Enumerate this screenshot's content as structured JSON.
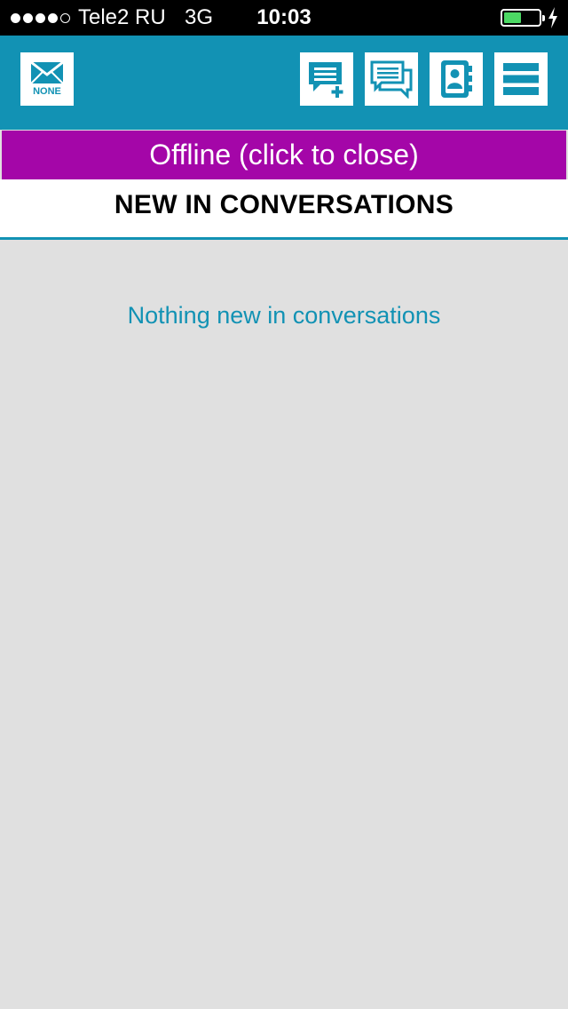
{
  "status_bar": {
    "carrier": "Tele2 RU",
    "network": "3G",
    "time": "10:03",
    "signal_bars_filled": 4,
    "signal_bars_total": 5,
    "battery_level": 0.5,
    "battery_color": "#4cd964"
  },
  "toolbar": {
    "mail_label": "NONE",
    "buttons": [
      {
        "icon": "new-message-icon"
      },
      {
        "icon": "conversations-icon"
      },
      {
        "icon": "contacts-icon"
      },
      {
        "icon": "menu-icon"
      }
    ]
  },
  "banner": {
    "text": "Offline (click to close)",
    "color": "#a406a8"
  },
  "section": {
    "title": "NEW IN CONVERSATIONS"
  },
  "content": {
    "empty_message": "Nothing new in conversations"
  },
  "theme": {
    "accent": "#1292b4",
    "background": "#e0e0e0"
  }
}
